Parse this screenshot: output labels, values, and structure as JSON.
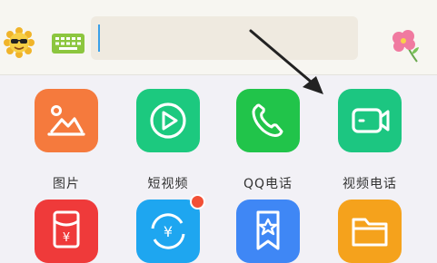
{
  "input": {
    "placeholder": ""
  },
  "top_icons": {
    "emoji": "sunglasses-emoji-icon",
    "keyboard": "keyboard-icon",
    "flower": "flower-icon"
  },
  "apps_row1": [
    {
      "label": "图片",
      "icon": "image-icon",
      "color": "#f57a3d"
    },
    {
      "label": "短视频",
      "icon": "play-icon",
      "color": "#1cc97f"
    },
    {
      "label": "QQ电话",
      "icon": "phone-icon",
      "color": "#21c44a"
    },
    {
      "label": "视频电话",
      "icon": "video-camera-icon",
      "color": "#1cc681"
    }
  ],
  "apps_row2": [
    {
      "icon": "red-packet-icon",
      "color": "#ef3a3a"
    },
    {
      "icon": "transfer-icon",
      "color": "#1ea6f0",
      "badge": true
    },
    {
      "icon": "favorites-icon",
      "color": "#3f87f5"
    },
    {
      "icon": "folder-icon",
      "color": "#f5a21c"
    }
  ]
}
